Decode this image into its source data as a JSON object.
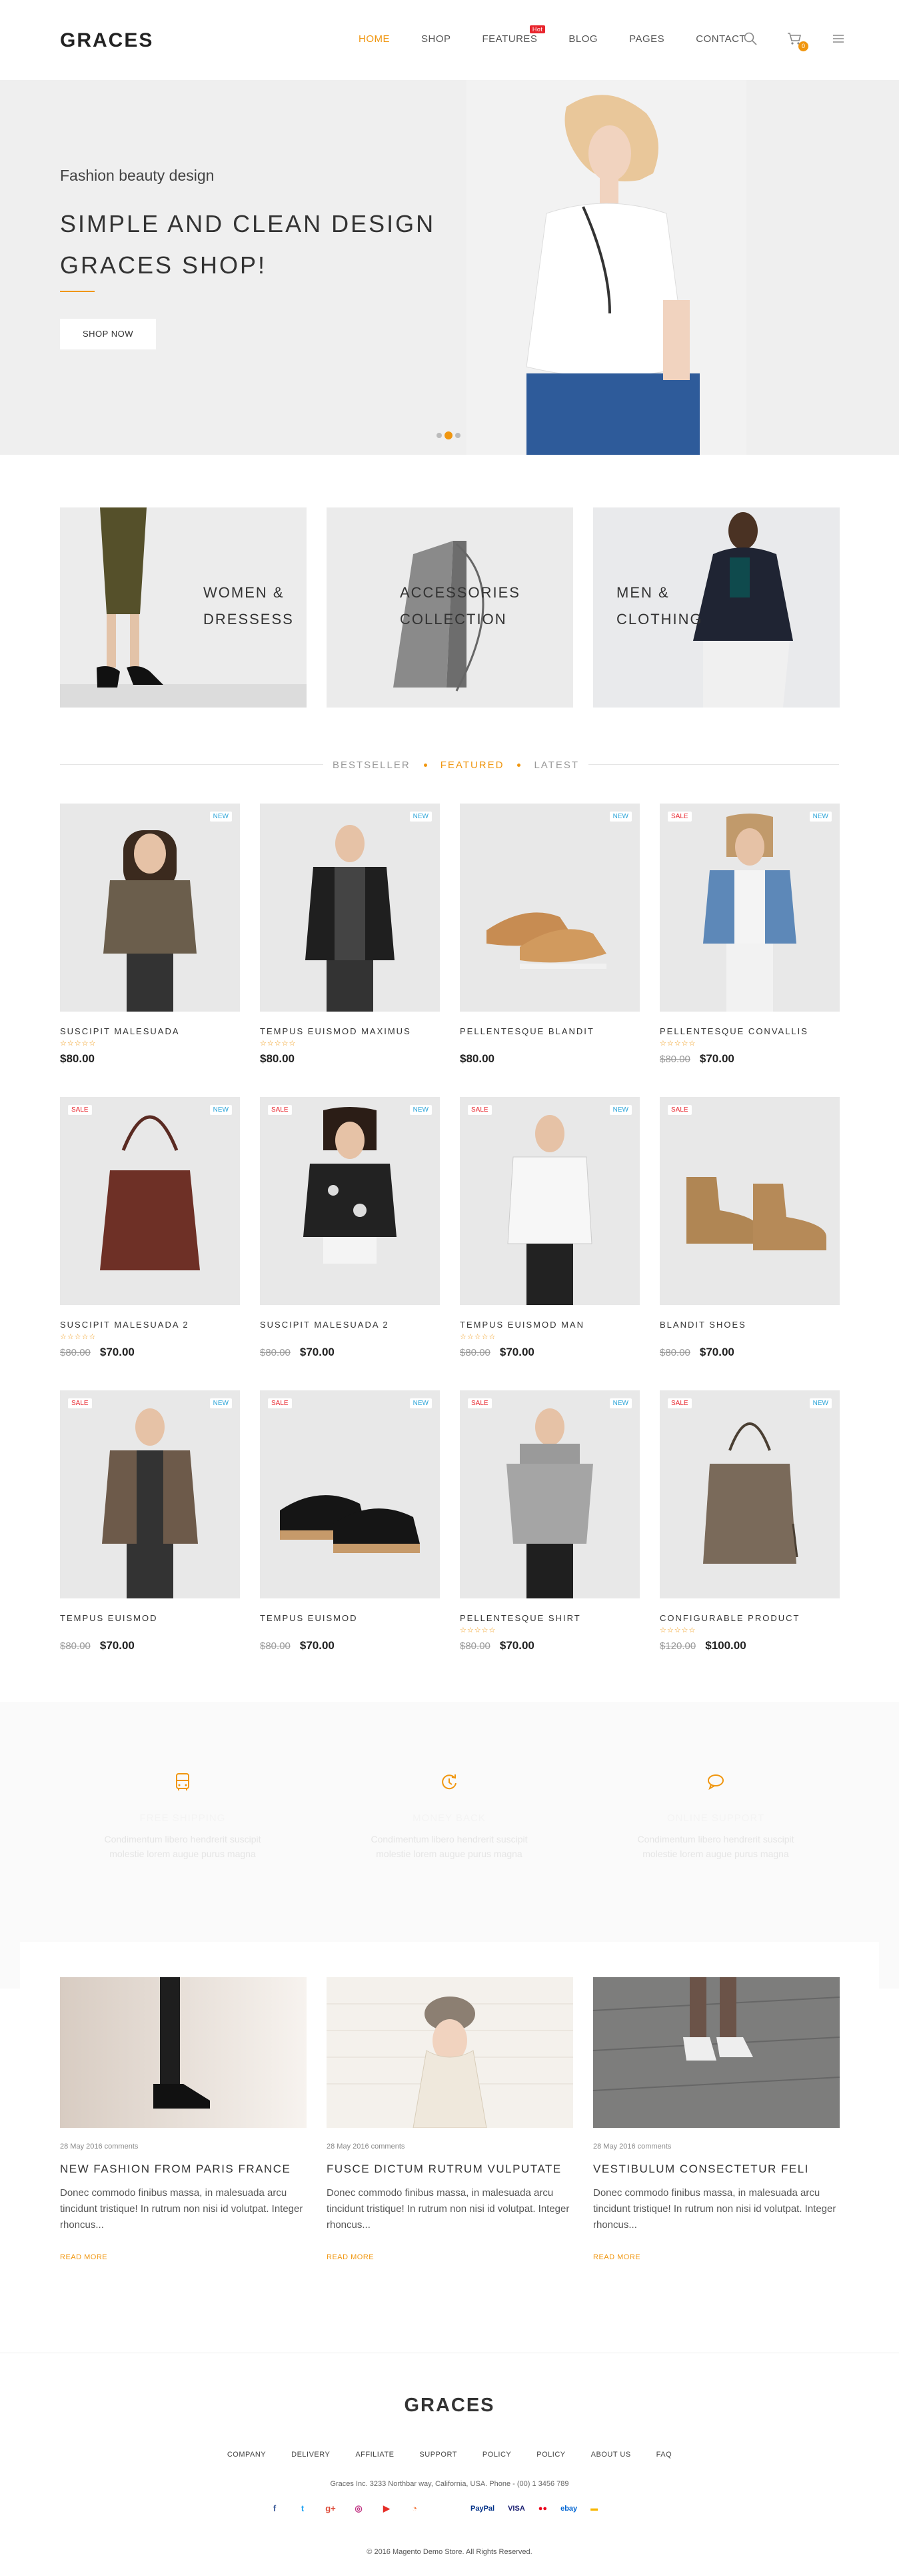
{
  "header": {
    "logo": "GRACES",
    "nav": [
      {
        "label": "HOME",
        "active": true
      },
      {
        "label": "SHOP",
        "active": false
      },
      {
        "label": "FEATURES",
        "active": false,
        "badge": "Hot"
      },
      {
        "label": "BLOG",
        "active": false
      },
      {
        "label": "PAGES",
        "active": false
      },
      {
        "label": "CONTACT",
        "active": false
      }
    ],
    "cart_count": "0"
  },
  "hero": {
    "subtitle": "Fashion beauty design",
    "title_line1": "SIMPLE AND CLEAN DESIGN",
    "title_line2": "GRACES SHOP!",
    "button": "SHOP NOW"
  },
  "categories": [
    {
      "line1": "WOMEN &",
      "line2": "DRESSESS"
    },
    {
      "line1": "ACCESSORIES",
      "line2": "COLLECTION"
    },
    {
      "line1": "MEN &",
      "line2": "CLOTHING"
    }
  ],
  "tabs": [
    "BESTSELLER",
    "FEATURED",
    "LATEST"
  ],
  "products": [
    {
      "name": "SUSCIPIT MALESUADA",
      "stars": "☆☆☆☆☆",
      "old_price": "",
      "price": "$80.00",
      "sale": false,
      "new": true
    },
    {
      "name": "TEMPUS EUISMOD MAXIMUS",
      "stars": "☆☆☆☆☆",
      "old_price": "",
      "price": "$80.00",
      "sale": false,
      "new": true
    },
    {
      "name": "PELLENTESQUE BLANDIT",
      "stars": "",
      "old_price": "",
      "price": "$80.00",
      "sale": false,
      "new": true
    },
    {
      "name": "PELLENTESQUE CONVALLIS",
      "stars": "☆☆☆☆☆",
      "old_price": "$80.00",
      "price": "$70.00",
      "sale": true,
      "new": true
    },
    {
      "name": "SUSCIPIT MALESUADA 2",
      "stars": "☆☆☆☆☆",
      "old_price": "$80.00",
      "price": "$70.00",
      "sale": true,
      "new": true
    },
    {
      "name": "SUSCIPIT MALESUADA 2",
      "stars": "",
      "old_price": "$80.00",
      "price": "$70.00",
      "sale": true,
      "new": true
    },
    {
      "name": "TEMPUS EUISMOD MAN",
      "stars": "☆☆☆☆☆",
      "old_price": "$80.00",
      "price": "$70.00",
      "sale": true,
      "new": true
    },
    {
      "name": "BLANDIT SHOES",
      "stars": "",
      "old_price": "$80.00",
      "price": "$70.00",
      "sale": true,
      "new": false
    },
    {
      "name": "TEMPUS EUISMOD",
      "stars": "",
      "old_price": "$80.00",
      "price": "$70.00",
      "sale": true,
      "new": true
    },
    {
      "name": "TEMPUS EUISMOD",
      "stars": "",
      "old_price": "$80.00",
      "price": "$70.00",
      "sale": true,
      "new": true
    },
    {
      "name": "PELLENTESQUE SHIRT",
      "stars": "☆☆☆☆☆",
      "old_price": "$80.00",
      "price": "$70.00",
      "sale": true,
      "new": true
    },
    {
      "name": "CONFIGURABLE PRODUCT",
      "stars": "☆☆☆☆☆",
      "old_price": "$120.00",
      "price": "$100.00",
      "sale": true,
      "new": true
    }
  ],
  "badges": {
    "new": "NEW",
    "sale": "SALE"
  },
  "services": [
    {
      "icon": "bus-icon",
      "title": "FREE SHIPPING",
      "text_line1": "Condimentum libero hendrerit suscipit",
      "text_line2": "molestie lorem augue purus magna"
    },
    {
      "icon": "refresh-icon",
      "title": "MONEY BACK",
      "text_line1": "Condimentum libero hendrerit suscipit",
      "text_line2": "molestie lorem augue purus magna"
    },
    {
      "icon": "chat-icon",
      "title": "ONLINE SUPPORT",
      "text_line1": "Condimentum libero hendrerit suscipit",
      "text_line2": "molestie lorem augue purus magna"
    }
  ],
  "blog": [
    {
      "date": "28 May 2016 comments",
      "title": "NEW FASHION FROM PARIS FRANCE",
      "text": "Donec commodo finibus massa, in malesuada arcu tincidunt tristique! In rutrum non nisi id volutpat. Integer rhoncus...",
      "more": "READ MORE"
    },
    {
      "date": "28 May 2016 comments",
      "title": "FUSCE DICTUM RUTRUM VULPUTATE",
      "text": "Donec commodo finibus massa, in malesuada arcu tincidunt tristique! In rutrum non nisi id volutpat. Integer rhoncus...",
      "more": "READ MORE"
    },
    {
      "date": "28 May 2016 comments",
      "title": "VESTIBULUM CONSECTETUR FELI",
      "text": "Donec commodo finibus massa, in malesuada arcu tincidunt tristique! In rutrum non nisi id volutpat. Integer rhoncus...",
      "more": "READ MORE"
    }
  ],
  "footer": {
    "logo": "GRACES",
    "links": [
      "COMPANY",
      "DELIVERY",
      "AFFILIATE",
      "SUPPORT",
      "POLICY",
      "POLICY",
      "ABOUT US",
      "FAQ"
    ],
    "address": "Graces Inc. 3233 Northbar way, California, USA. Phone - (00) 1 3456 789",
    "social": [
      {
        "icon": "facebook-icon",
        "glyph": "f",
        "color": "#3b5998"
      },
      {
        "icon": "twitter-icon",
        "glyph": "t",
        "color": "#1da1f2"
      },
      {
        "icon": "google-plus-icon",
        "glyph": "g+",
        "color": "#dd4b39"
      },
      {
        "icon": "instagram-icon",
        "glyph": "◎",
        "color": "#c13584"
      },
      {
        "icon": "youtube-icon",
        "glyph": "▶",
        "color": "#e52d27"
      },
      {
        "icon": "rss-icon",
        "glyph": "◔",
        "color": "#f26522"
      }
    ],
    "payments": [
      {
        "icon": "paypal-icon",
        "label": "PayPal",
        "color": "#003087"
      },
      {
        "icon": "visa-icon",
        "label": "VISA",
        "color": "#1a1f71"
      },
      {
        "icon": "mastercard-icon",
        "label": "●●",
        "color": "#eb001b"
      },
      {
        "icon": "ebay-icon",
        "label": "ebay",
        "color": "#0064d2"
      },
      {
        "icon": "card-icon",
        "label": "▬",
        "color": "#f7b600"
      }
    ],
    "copyright": "© 2016 Magento Demo Store. All Rights Reserved."
  },
  "colors": {
    "accent": "#f0960f",
    "new_badge": "#2aa4d8",
    "sale_badge": "#e8252d"
  }
}
